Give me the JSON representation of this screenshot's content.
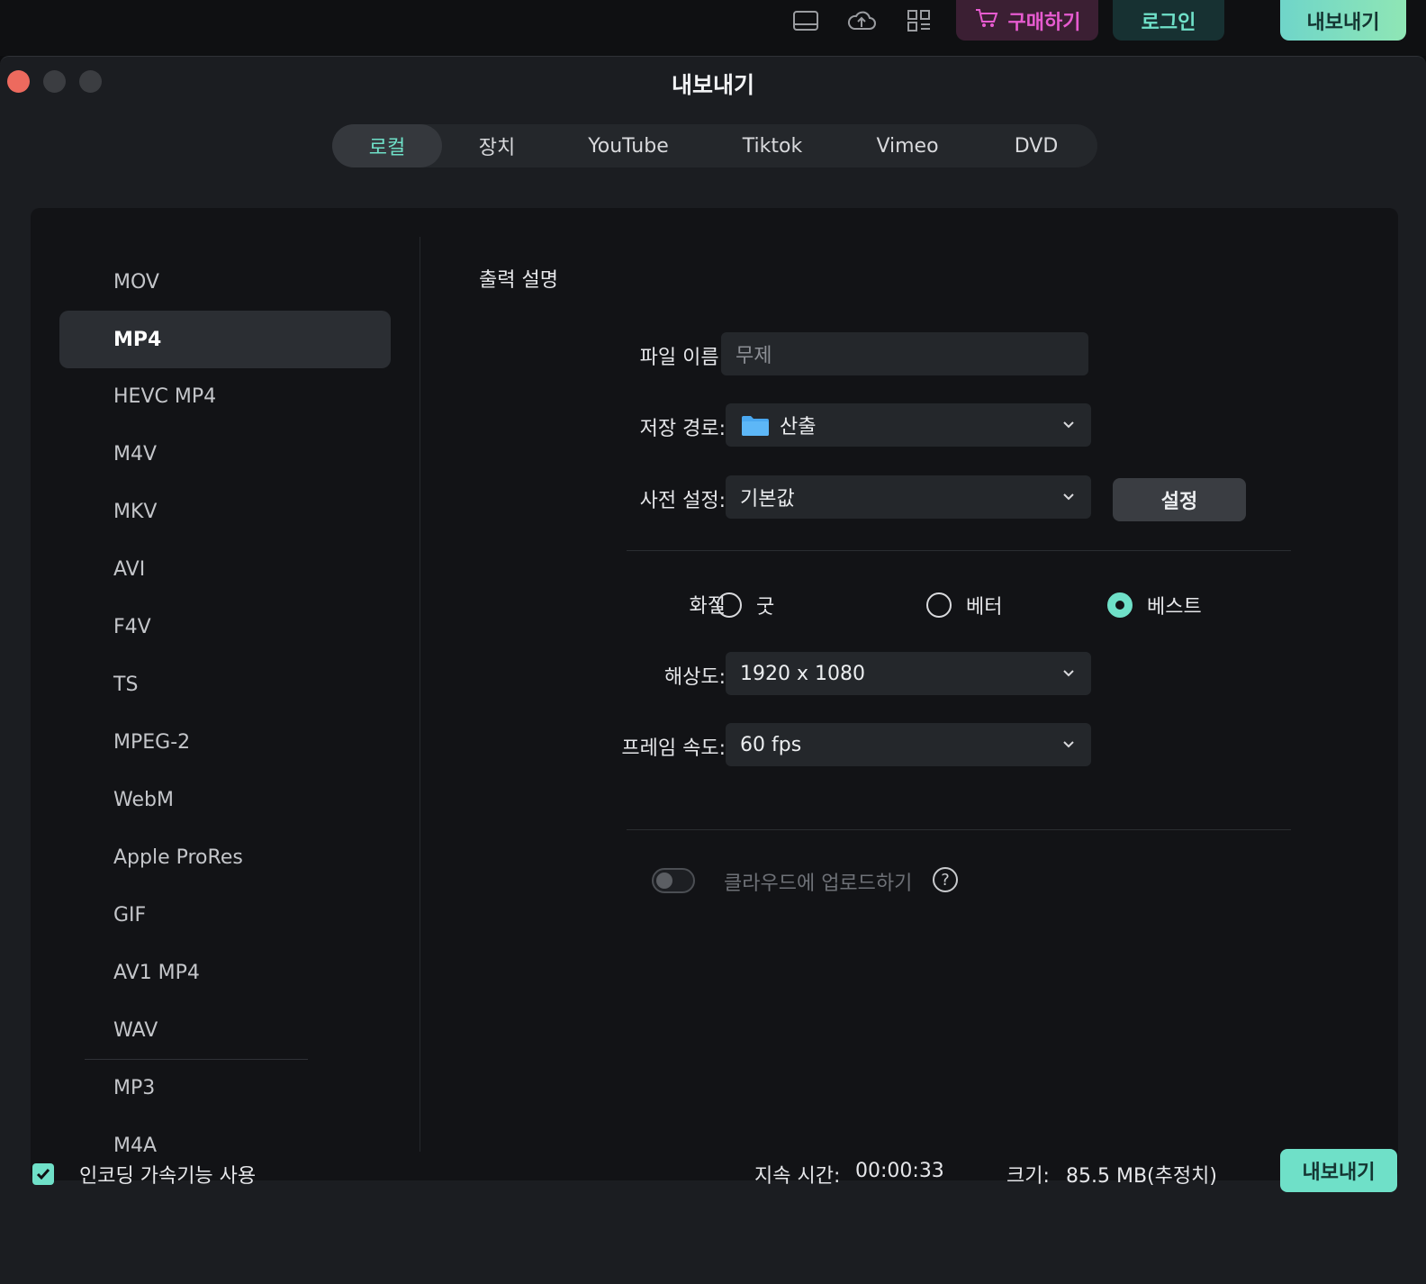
{
  "appbar": {
    "buy_label": "구매하기",
    "login_label": "로그인",
    "export_label": "내보내기"
  },
  "window": {
    "title": "내보내기",
    "tabs": [
      "로컬",
      "장치",
      "YouTube",
      "Tiktok",
      "Vimeo",
      "DVD"
    ]
  },
  "formats": [
    "MOV",
    "MP4",
    "HEVC MP4",
    "M4V",
    "MKV",
    "AVI",
    "F4V",
    "TS",
    "MPEG-2",
    "WebM",
    "Apple ProRes",
    "GIF",
    "AV1 MP4",
    "WAV",
    "MP3",
    "M4A"
  ],
  "selected_format": "MP4",
  "settings": {
    "section_title": "출력 설명",
    "file_name_label": "파일 이름:",
    "file_name_value": "무제",
    "save_path_label": "저장 경로:",
    "save_path_value": "산출",
    "preset_label": "사전 설정:",
    "preset_value": "기본값",
    "preset_button": "설정",
    "quality_label": "화질",
    "quality_options": [
      "굿",
      "베터",
      "베스트"
    ],
    "quality_selected": "베스트",
    "resolution_label": "해상도:",
    "resolution_value": "1920 x 1080",
    "framerate_label": "프레임 속도:",
    "framerate_value": "60 fps",
    "cloud_label": "클라우드에 업로드하기",
    "help_glyph": "?"
  },
  "footer": {
    "encoding_label": "인코딩 가속기능 사용",
    "duration_label": "지속 시간:",
    "duration_value": "00:00:33",
    "size_label": "크기:",
    "size_value": "85.5 MB(추정치)",
    "export_button": "내보내기"
  },
  "colors": {
    "accent": "#6fe0c8",
    "buy": "#e75bd0",
    "close": "#ed6a5e"
  }
}
